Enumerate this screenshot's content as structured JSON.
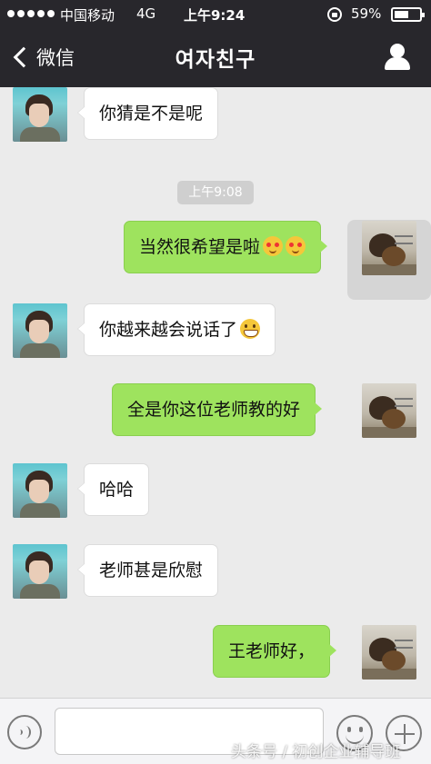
{
  "status_bar": {
    "carrier": "中国移动",
    "network": "4G",
    "time": "上午9:24",
    "battery": "59%",
    "battery_level": 0.59
  },
  "nav": {
    "back_label": "微信",
    "title": "여자친구",
    "back_icon": "chevron-left-icon",
    "profile_icon": "person-icon"
  },
  "timestamp": "上午9:08",
  "messages": [
    {
      "from": "friend",
      "text": "你猜是不是呢"
    },
    {
      "from": "me",
      "text": "当然很希望是啦",
      "emoji": [
        "heart-eyes-emoji",
        "heart-eyes-emoji"
      ]
    },
    {
      "from": "friend",
      "text": "你越来越会说话了",
      "emoji": [
        "grin-emoji"
      ]
    },
    {
      "from": "me",
      "text": "全是你这位老师教的好"
    },
    {
      "from": "friend",
      "text": "哈哈"
    },
    {
      "from": "friend",
      "text": "老师甚是欣慰"
    },
    {
      "from": "me",
      "text": "王老师好，"
    }
  ],
  "input_bar": {
    "voice_icon": "voice-icon",
    "emoji_icon": "smiley-icon",
    "plus_icon": "plus-icon",
    "text_value": ""
  },
  "watermark": "头条号 / 初创企业辅导班",
  "colors": {
    "header": "#28272c",
    "chat_bg": "#ebebeb",
    "outgoing_bubble": "#9ee35e",
    "incoming_bubble": "#ffffff"
  }
}
